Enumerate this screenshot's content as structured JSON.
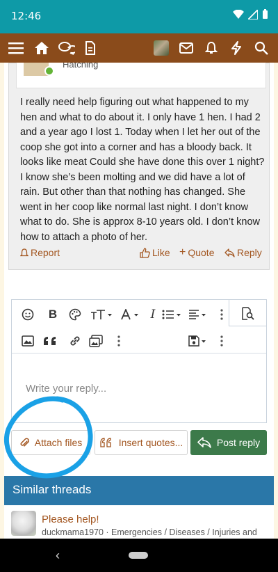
{
  "status_bar": {
    "time": "12:46"
  },
  "nav": {
    "icons": [
      "menu-icon",
      "home-icon",
      "chat-icon",
      "document-icon",
      "avatar",
      "mail-icon",
      "bell-icon",
      "lightning-icon",
      "search-icon"
    ]
  },
  "post": {
    "author_title": "Hatching",
    "body": "I really need help figuring out what happened to my hen and what to do about it. I only have 1 hen. I had 2 and a year ago I lost 1. Today when I let her out of the coop she got into a corner and has a bloody back. It looks like meat Could she have done this over 1 night? I know she’s been molting and we did have a lot of rain. But other than that nothing has changed. She went in her coop like normal last night. I don’t know what to do. She is approx 8-10 years old. I don’t know how to attach a photo of her.",
    "actions": {
      "report": "Report",
      "like": "Like",
      "quote": "Quote",
      "reply": "Reply"
    }
  },
  "editor": {
    "placeholder": "Write your reply...",
    "bold": "B",
    "italic": "I"
  },
  "buttons": {
    "attach": "Attach files",
    "insert_quotes": "Insert quotes...",
    "post_reply": "Post reply"
  },
  "similar_threads": {
    "heading": "Similar threads",
    "items": [
      {
        "title": "Please help!",
        "meta": "duckmama1970 · Emergencies / Diseases / Injuries and"
      }
    ]
  },
  "colors": {
    "header": "#8a4b1b",
    "statusbar": "#0e9aa7",
    "accent_link": "#a2551f",
    "post_button": "#3c7a4a",
    "section_header": "#2a77a8",
    "annotation": "#1aa1e6"
  }
}
